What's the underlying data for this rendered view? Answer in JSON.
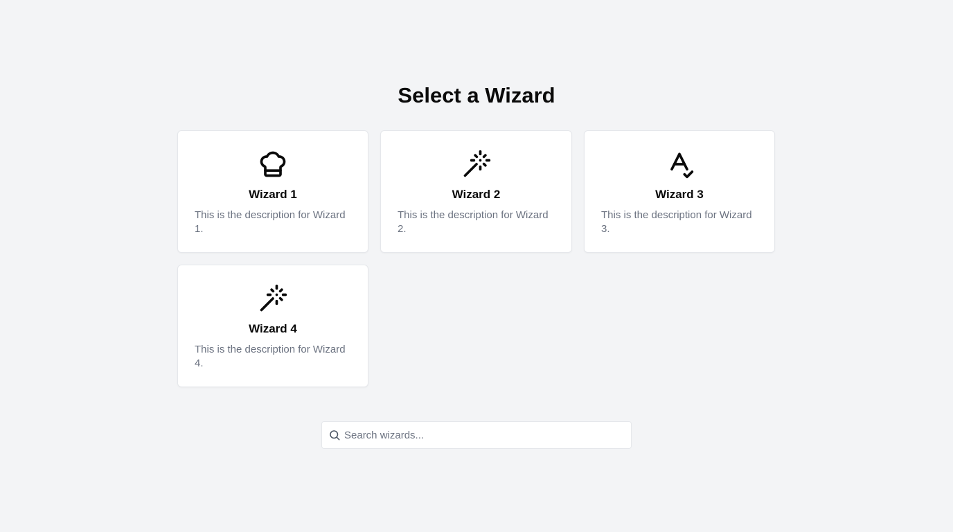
{
  "page": {
    "title": "Select a Wizard"
  },
  "wizards": [
    {
      "title": "Wizard 1",
      "description": "This is the description for Wizard 1.",
      "icon": "chef-hat-icon"
    },
    {
      "title": "Wizard 2",
      "description": "This is the description for Wizard 2.",
      "icon": "magic-wand-icon"
    },
    {
      "title": "Wizard 3",
      "description": "This is the description for Wizard 3.",
      "icon": "spell-check-icon"
    },
    {
      "title": "Wizard 4",
      "description": "This is the description for Wizard 4.",
      "icon": "magic-wand-icon"
    }
  ],
  "search": {
    "placeholder": "Search wizards...",
    "value": "",
    "icon": "search-icon"
  },
  "colors": {
    "background": "#f3f4f6",
    "card_background": "#ffffff",
    "card_border": "#e5e7eb",
    "title_text": "#0a0a0a",
    "description_text": "#6b7280"
  }
}
